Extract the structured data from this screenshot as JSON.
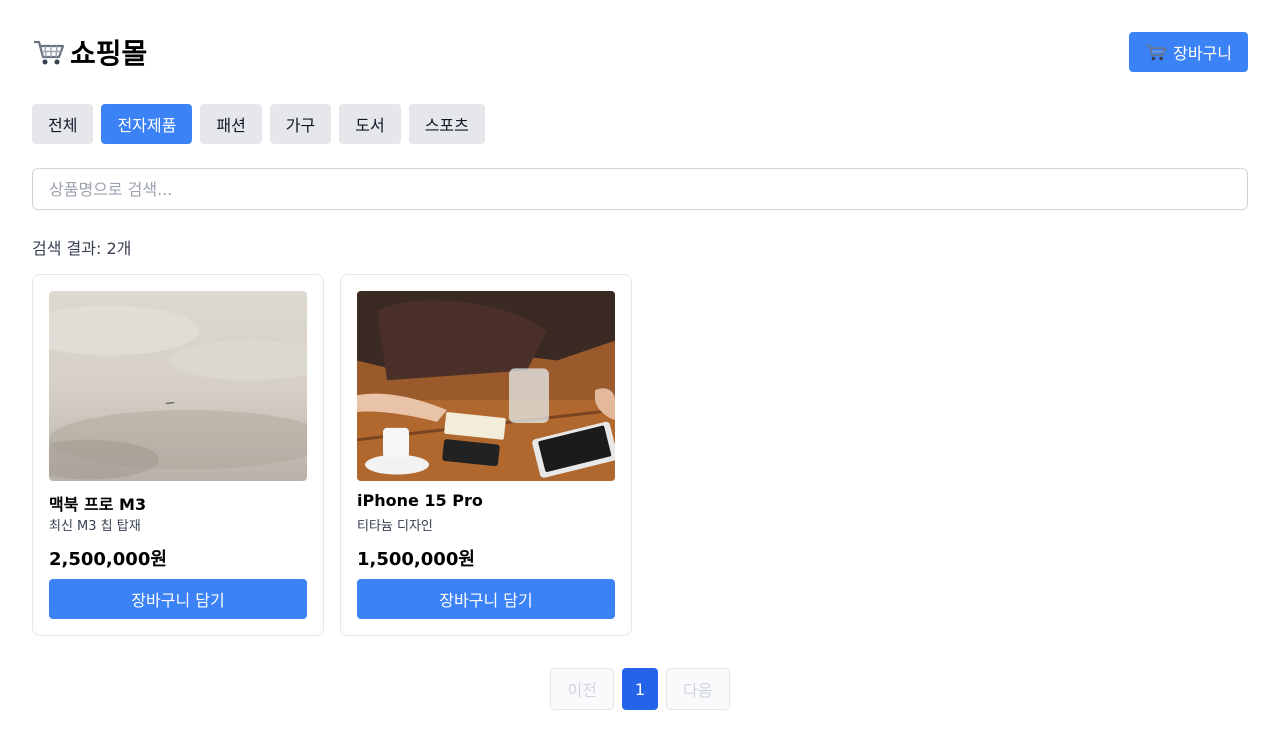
{
  "header": {
    "logo_text": "쇼핑몰",
    "cart_button_label": "장바구니"
  },
  "categories": [
    {
      "label": "전체",
      "active": false
    },
    {
      "label": "전자제품",
      "active": true
    },
    {
      "label": "패션",
      "active": false
    },
    {
      "label": "가구",
      "active": false
    },
    {
      "label": "도서",
      "active": false
    },
    {
      "label": "스포츠",
      "active": false
    }
  ],
  "search": {
    "placeholder": "상품명으로 검색...",
    "value": ""
  },
  "results": {
    "count_text": "검색 결과: 2개"
  },
  "products": [
    {
      "name": "맥북 프로 M3",
      "description": "최신 M3 칩 탑재",
      "price": "2,500,000원",
      "add_button_label": "장바구니 담기"
    },
    {
      "name": "iPhone 15 Pro",
      "description": "티타늄 디자인",
      "price": "1,500,000원",
      "add_button_label": "장바구니 담기"
    }
  ],
  "pagination": {
    "prev_label": "이전",
    "current_page": "1",
    "next_label": "다음"
  },
  "colors": {
    "accent": "#3b82f6",
    "accent_dark": "#2563eb",
    "tab_inactive": "#e5e7eb"
  }
}
